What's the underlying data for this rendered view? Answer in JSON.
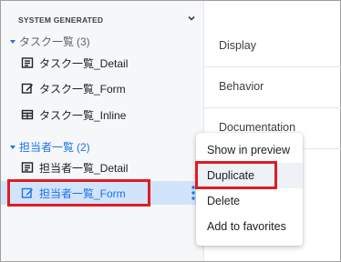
{
  "sidebar": {
    "section_title": "SYSTEM GENERATED",
    "groups": [
      {
        "label": "タスク一覧",
        "count": "(3)",
        "items": [
          {
            "label": "タスク一覧_Detail",
            "icon": "detail-view-icon"
          },
          {
            "label": "タスク一覧_Form",
            "icon": "form-edit-icon"
          },
          {
            "label": "タスク一覧_Inline",
            "icon": "table-icon"
          }
        ]
      },
      {
        "label": "担当者一覧",
        "count": "(2)",
        "items": [
          {
            "label": "担当者一覧_Detail",
            "icon": "detail-view-icon"
          },
          {
            "label": "担当者一覧_Form",
            "icon": "form-edit-icon",
            "selected": true
          }
        ]
      }
    ]
  },
  "main": {
    "rows": [
      "Display",
      "Behavior",
      "Documentation"
    ]
  },
  "context_menu": {
    "items": [
      "Show in preview",
      "Duplicate",
      "Delete",
      "Add to favorites"
    ],
    "hovered": "Duplicate"
  },
  "colors": {
    "accent_blue": "#1a73e8",
    "selected_bg": "#d2e3fc",
    "highlight_red": "#e11b22"
  }
}
